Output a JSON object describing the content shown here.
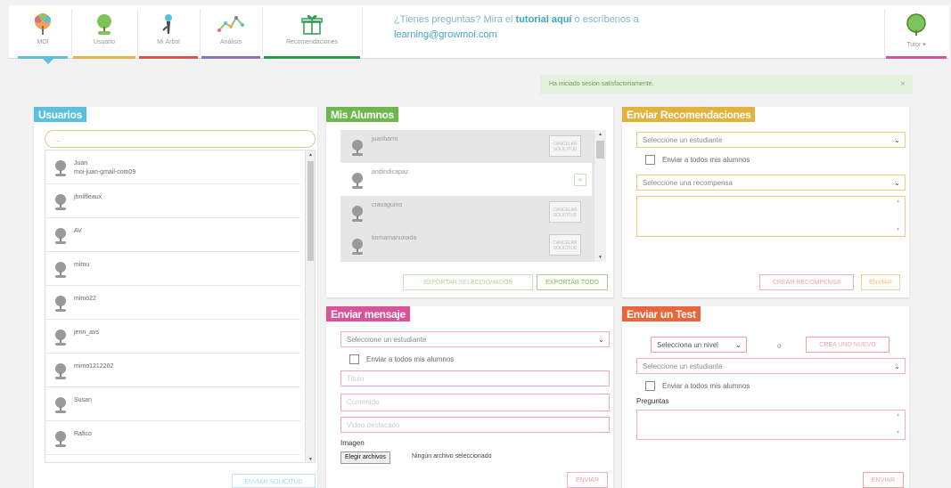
{
  "nav": {
    "items": [
      {
        "label": "MOI",
        "icon": "tree-logo-icon",
        "color": "#5bc0de"
      },
      {
        "label": "Usuario",
        "icon": "user-avatar-icon",
        "color": "#f0ad4e"
      },
      {
        "label": "Mi Árbol",
        "icon": "tree-icon",
        "color": "#d9534f"
      },
      {
        "label": "Análisis",
        "icon": "chart-line-icon",
        "color": "#8e6fbf"
      },
      {
        "label": "Recomendaciones",
        "icon": "gift-icon",
        "color": "#2a9d4a"
      }
    ],
    "tutor_label": "Tutor ▾",
    "tutor_color": "#d9539b"
  },
  "message": {
    "prefix": "¿Tienes preguntas? Mira el ",
    "link": "tutorial aquí",
    "suffix": " o escríbenos a",
    "email": "learning@growmoi.com"
  },
  "alert": {
    "text": "Ha iniciado sesion satisfactoriamente.",
    "close": "×"
  },
  "usuarios": {
    "title": "Usuarios",
    "title_color": "#5bc0de",
    "search_placeholder": "...",
    "users": [
      {
        "name": "Juan",
        "sub": "moi-juan-gmail-com09"
      },
      {
        "name": "jhnilfleaux",
        "sub": ""
      },
      {
        "name": "AV",
        "sub": ""
      },
      {
        "name": "mimu",
        "sub": ""
      },
      {
        "name": "mimo22",
        "sub": ""
      },
      {
        "name": "jenn_avs",
        "sub": ""
      },
      {
        "name": "mimo1212202",
        "sub": ""
      },
      {
        "name": "Susan",
        "sub": ""
      },
      {
        "name": "Rafico",
        "sub": ""
      }
    ],
    "button": "ENVIAR SOLICITUD"
  },
  "alumnos": {
    "title": "Mis Alumnos",
    "title_color": "#6cb84a",
    "students": [
      {
        "name": "juanbarro",
        "action": "CANCELAR SOLICITUD"
      },
      {
        "name": "andindicapaz",
        "action": "+"
      },
      {
        "name": "cravaguino",
        "action": "CANCELAR SOLICITUD"
      },
      {
        "name": "tiomamanunada",
        "action": "CANCELAR SOLICITUD"
      }
    ],
    "export_selected": "EXPORTAR SELECCIONADOS",
    "export_all": "EXPORTAR TODO"
  },
  "recomendaciones": {
    "title": "Enviar Recomendaciones",
    "title_color": "#e2b23c",
    "student_select": "Seleccione un estudiante",
    "all_students": "Enviar a todos mis alumnos",
    "reward_select": "Seleccione una recompensa",
    "create_button": "CREAR RECOMPENSA",
    "send_button": "ENVIAR"
  },
  "mensaje": {
    "title": "Enviar mensaje",
    "title_color": "#d9539b",
    "student_select": "Seleccione un estudiante",
    "all_students": "Enviar a todos mis alumnos",
    "title_placeholder": "Titulo",
    "content_placeholder": "Contenido",
    "video_placeholder": "Video destacado",
    "image_label": "Imagen",
    "file_button": "Elegir archivos",
    "file_status": "Ningún archivo seleccionado",
    "send_button": "ENVIAR"
  },
  "test": {
    "title": "Enviar un Test",
    "title_color": "#e8663c",
    "level_select": "Selecciona un nivel",
    "or_label": "o",
    "create_button": "CREA UNO NUEVO",
    "student_select": "Seleccione un estudiante",
    "all_students": "Enviar a todos mis alumnos",
    "questions_label": "Preguntas",
    "send_button": "ENVIAR"
  }
}
